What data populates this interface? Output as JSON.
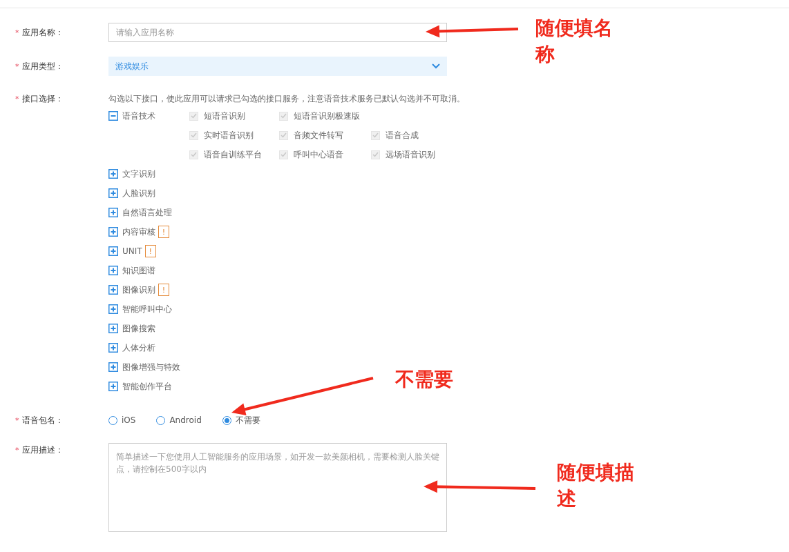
{
  "name_field": {
    "mark": "*",
    "label": "应用名称：",
    "placeholder": "请输入应用名称"
  },
  "type_field": {
    "mark": "*",
    "label": "应用类型：",
    "value": "游戏娱乐"
  },
  "api_field": {
    "mark": "*",
    "label": "接口选择：",
    "hint": "勾选以下接口，使此应用可以请求已勾选的接口服务，注意语音技术服务已默认勾选并不可取消。",
    "groups": [
      {
        "name": "语音技术",
        "expanded": true,
        "options": [
          {
            "label": "短语音识别",
            "checked": true,
            "disabled": true
          },
          {
            "label": "短语音识别极速版",
            "checked": true,
            "disabled": true
          },
          {
            "label": "实时语音识别",
            "checked": true,
            "disabled": true
          },
          {
            "label": "音频文件转写",
            "checked": true,
            "disabled": true
          },
          {
            "label": "语音合成",
            "checked": true,
            "disabled": true
          },
          {
            "label": "语音自训练平台",
            "checked": true,
            "disabled": true
          },
          {
            "label": "呼叫中心语音",
            "checked": true,
            "disabled": true
          },
          {
            "label": "远场语音识别",
            "checked": true,
            "disabled": true
          }
        ]
      },
      {
        "name": "文字识别",
        "expanded": false
      },
      {
        "name": "人脸识别",
        "expanded": false
      },
      {
        "name": "自然语言处理",
        "expanded": false
      },
      {
        "name": "内容审核",
        "expanded": false,
        "badge": "!"
      },
      {
        "name": "UNIT",
        "expanded": false,
        "badge": "!"
      },
      {
        "name": "知识图谱",
        "expanded": false
      },
      {
        "name": "图像识别",
        "expanded": false,
        "badge": "!"
      },
      {
        "name": "智能呼叫中心",
        "expanded": false
      },
      {
        "name": "图像搜索",
        "expanded": false
      },
      {
        "name": "人体分析",
        "expanded": false
      },
      {
        "name": "图像增强与特效",
        "expanded": false
      },
      {
        "name": "智能创作平台",
        "expanded": false
      }
    ]
  },
  "package_field": {
    "mark": "*",
    "label": "语音包名：",
    "options": [
      {
        "label": "iOS",
        "selected": false
      },
      {
        "label": "Android",
        "selected": false
      },
      {
        "label": "不需要",
        "selected": true
      }
    ]
  },
  "desc_field": {
    "mark": "*",
    "label": "应用描述：",
    "placeholder": "简单描述一下您使用人工智能服务的应用场景，如开发一款美颜相机，需要检测人脸关键点，请控制在500字以内"
  },
  "annotations": [
    {
      "text": "随便填名称"
    },
    {
      "text": "不需要"
    },
    {
      "text": "随便填描述"
    }
  ]
}
